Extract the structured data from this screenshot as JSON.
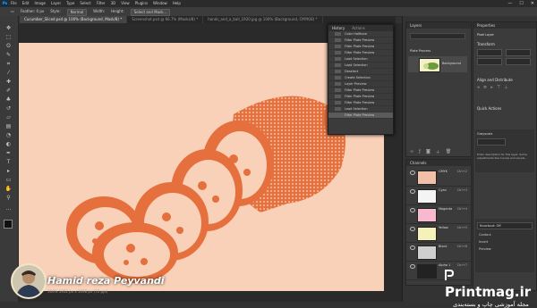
{
  "app": {
    "logo": "Ps"
  },
  "menu": [
    "File",
    "Edit",
    "Image",
    "Layer",
    "Type",
    "Select",
    "Filter",
    "3D",
    "View",
    "Plugins",
    "Window",
    "Help"
  ],
  "window_controls": [
    "—",
    "☐",
    "✕"
  ],
  "options": {
    "feather_label": "Feather: 0 px",
    "style_label": "Style:",
    "style_value": "Normal",
    "width_label": "Width:",
    "height_label": "Height:",
    "select_mask": "Select and Mask..."
  },
  "tabs": [
    {
      "label": "Cucumber_Sliced.psd @ 100% (Background, Mask/8) *",
      "active": true
    },
    {
      "label": "Screenshot.psd @ 66.7% (Masks/8) *",
      "active": false
    },
    {
      "label": "hands_and_a_ball_1920.jpg @ 100% (Background, CMYK/8) *",
      "active": false
    }
  ],
  "history": {
    "tabs": [
      "History",
      "Actions"
    ],
    "items": [
      "Color Halftone",
      "Filter Plate Preview",
      "Filter Plate Preview",
      "Filter Plate Preview",
      "Load Selection",
      "Load Selection",
      "Deselect",
      "Create Selection",
      "Layer Preview",
      "Filter Plate Preview",
      "Filter Plate Preview",
      "Filter Plate Preview",
      "Load Selection",
      "Filter Plate Preview"
    ],
    "selected_index": 13
  },
  "layers": {
    "title": "Layers",
    "group_label": "Plate Process",
    "layer_label": "Background"
  },
  "channels": {
    "title": "Channels",
    "rows": [
      {
        "label": "CMYK",
        "shortcut": "Ctrl+2"
      },
      {
        "label": "Cyan",
        "shortcut": "Ctrl+3"
      },
      {
        "label": "Magenta",
        "shortcut": "Ctrl+4"
      },
      {
        "label": "Yellow",
        "shortcut": "Ctrl+5"
      },
      {
        "label": "Black",
        "shortcut": "Ctrl+6"
      },
      {
        "label": "Alpha 1",
        "shortcut": "Ctrl+7"
      }
    ]
  },
  "properties": {
    "title": "Properties",
    "doc_label": "Pixel Layer",
    "sections": [
      "Transform",
      "Align and Distribute",
      "Quick Actions"
    ],
    "mode_label": "Grayscale",
    "description": "Enter description for this layer. Some adjustments like Curves and Levels...",
    "knockout_label": "Knockout: Off",
    "toggles": [
      "Contour",
      "Invert",
      "Preview"
    ]
  },
  "presenter": {
    "name": "Hamid reza Peyvandi"
  },
  "statusbar": {
    "text": "100%   1952 px x 1098 px (72 ppi)"
  },
  "brand": {
    "name": "Printmag.ir",
    "tagline": "مجله آموزشی چاپ و بسته‌بندی"
  },
  "colors": {
    "canvas_bg": "#f9d0b8",
    "cucumber": "#e5703d",
    "ui_dark": "#323232"
  }
}
